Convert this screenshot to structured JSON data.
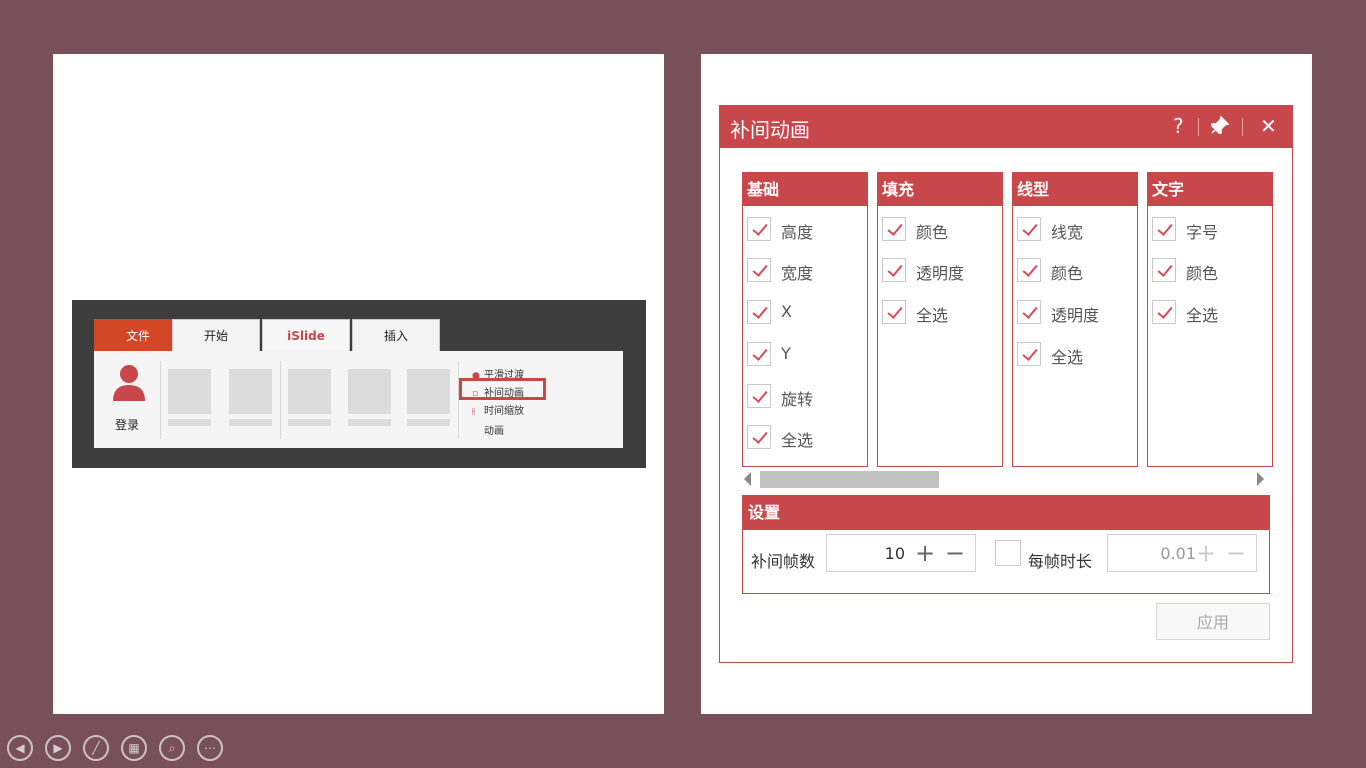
{
  "ribbon": {
    "tabs": [
      "文件",
      "开始",
      "iSlide",
      "插入"
    ],
    "login_label": "登录",
    "smooth_transition": "平滑过渡",
    "tween_animation": "补间动画",
    "time_zoom": "时间缩放",
    "group_label": "动画"
  },
  "dialog": {
    "title": "补间动画",
    "help": "?",
    "pin": "📌",
    "close": "✕",
    "panels": [
      {
        "head": "基础",
        "items": [
          "高度",
          "宽度",
          "X",
          "Y",
          "旋转",
          "全选"
        ]
      },
      {
        "head": "填充",
        "items": [
          "颜色",
          "透明度",
          "全选"
        ]
      },
      {
        "head": "线型",
        "items": [
          "线宽",
          "颜色",
          "透明度",
          "全选"
        ]
      },
      {
        "head": "文字",
        "items": [
          "字号",
          "颜色",
          "全选"
        ]
      }
    ],
    "settings": {
      "head": "设置",
      "frames_label": "补间帧数",
      "frames_value": "10",
      "plus": "+",
      "minus": "−",
      "duration_label": "每帧时长",
      "duration_value": "0.01"
    },
    "apply": "应用"
  },
  "nav_icons": [
    "prev-icon",
    "next-icon",
    "pen-icon",
    "slides-icon",
    "zoom-icon",
    "more-icon"
  ],
  "colors": {
    "accent": "#c8474b",
    "background": "#77505b"
  }
}
